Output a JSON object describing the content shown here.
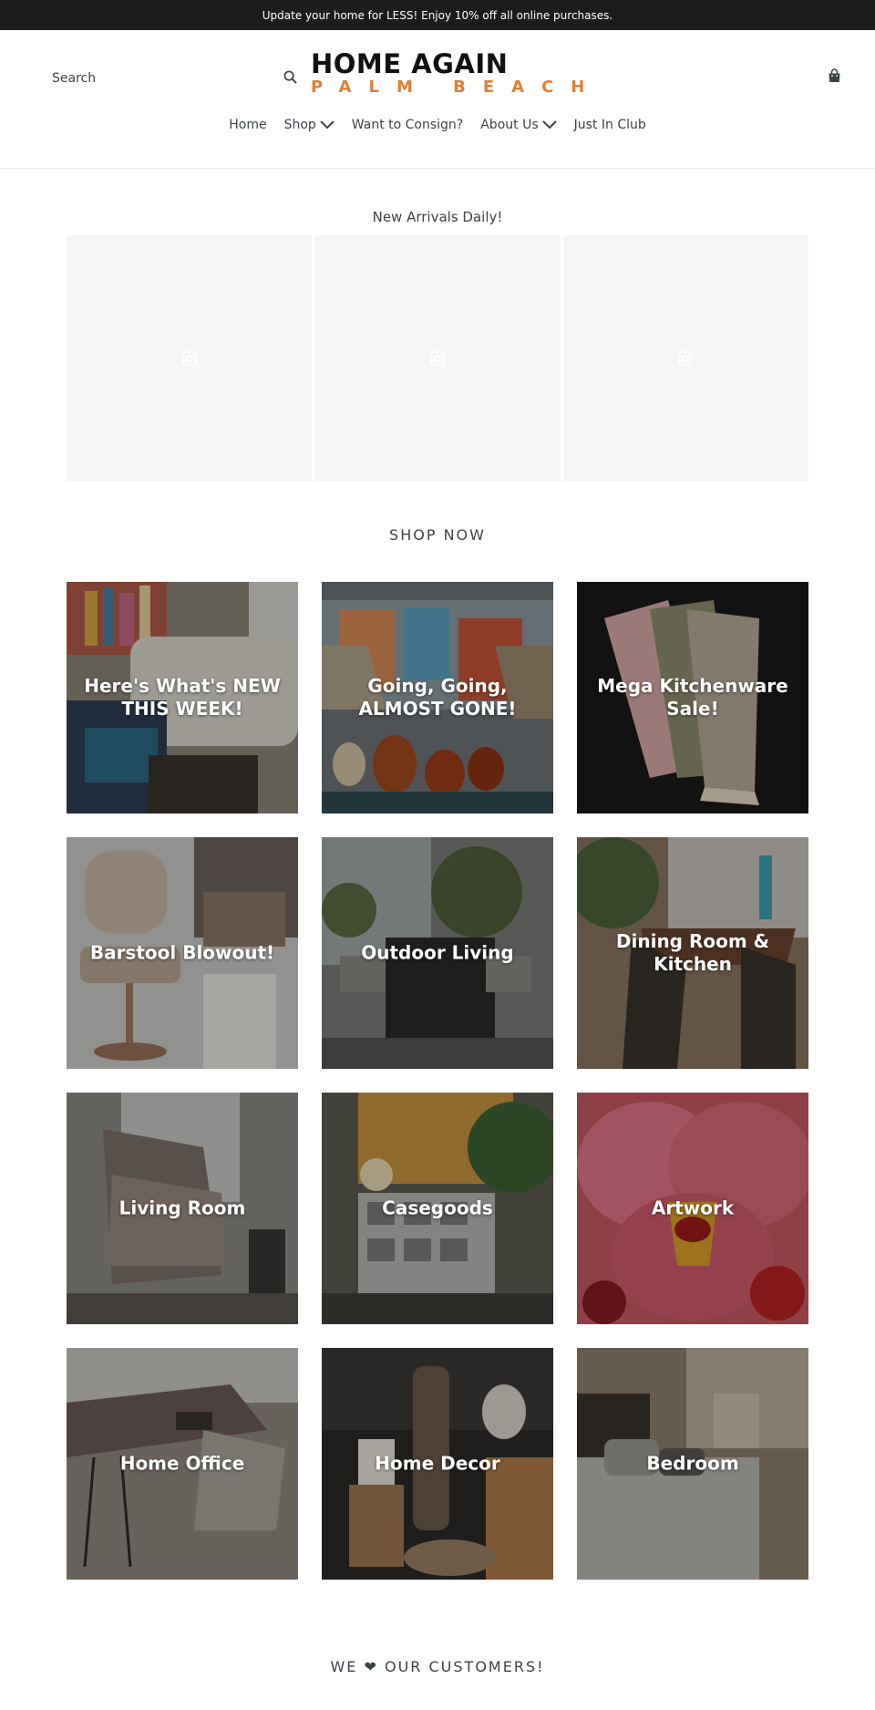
{
  "announcement": {
    "text": "Update your home for LESS! Enjoy 10% off all online purchases."
  },
  "header": {
    "search_placeholder": "Search",
    "search_icon": "search-icon",
    "logo": {
      "main": "HOME AGAIN",
      "sub": "PALM BEACH",
      "brand_color": "#e07f35"
    },
    "cart_icon": "cart-icon"
  },
  "nav": {
    "items": [
      {
        "label": "Home",
        "dropdown": false
      },
      {
        "label": "Shop",
        "dropdown": true
      },
      {
        "label": "Want to Consign?",
        "dropdown": false
      },
      {
        "label": "About Us",
        "dropdown": true
      },
      {
        "label": "Just In Club",
        "dropdown": false
      }
    ]
  },
  "instagram": {
    "title": "New Arrivals Daily!",
    "tile_icon": "instagram-icon"
  },
  "shop": {
    "title": "SHOP NOW",
    "collections": [
      {
        "label": "Here's What's NEW THIS WEEK!"
      },
      {
        "label": "Going, Going, ALMOST GONE!"
      },
      {
        "label": "Mega Kitchenware Sale!"
      },
      {
        "label": "Barstool Blowout!"
      },
      {
        "label": "Outdoor Living"
      },
      {
        "label": "Dining Room & Kitchen"
      },
      {
        "label": "Living Room"
      },
      {
        "label": "Casegoods"
      },
      {
        "label": "Artwork"
      },
      {
        "label": "Home Office"
      },
      {
        "label": "Home Decor"
      },
      {
        "label": "Bedroom"
      }
    ]
  },
  "customers": {
    "title": "WE ❤ OUR CUSTOMERS!"
  }
}
